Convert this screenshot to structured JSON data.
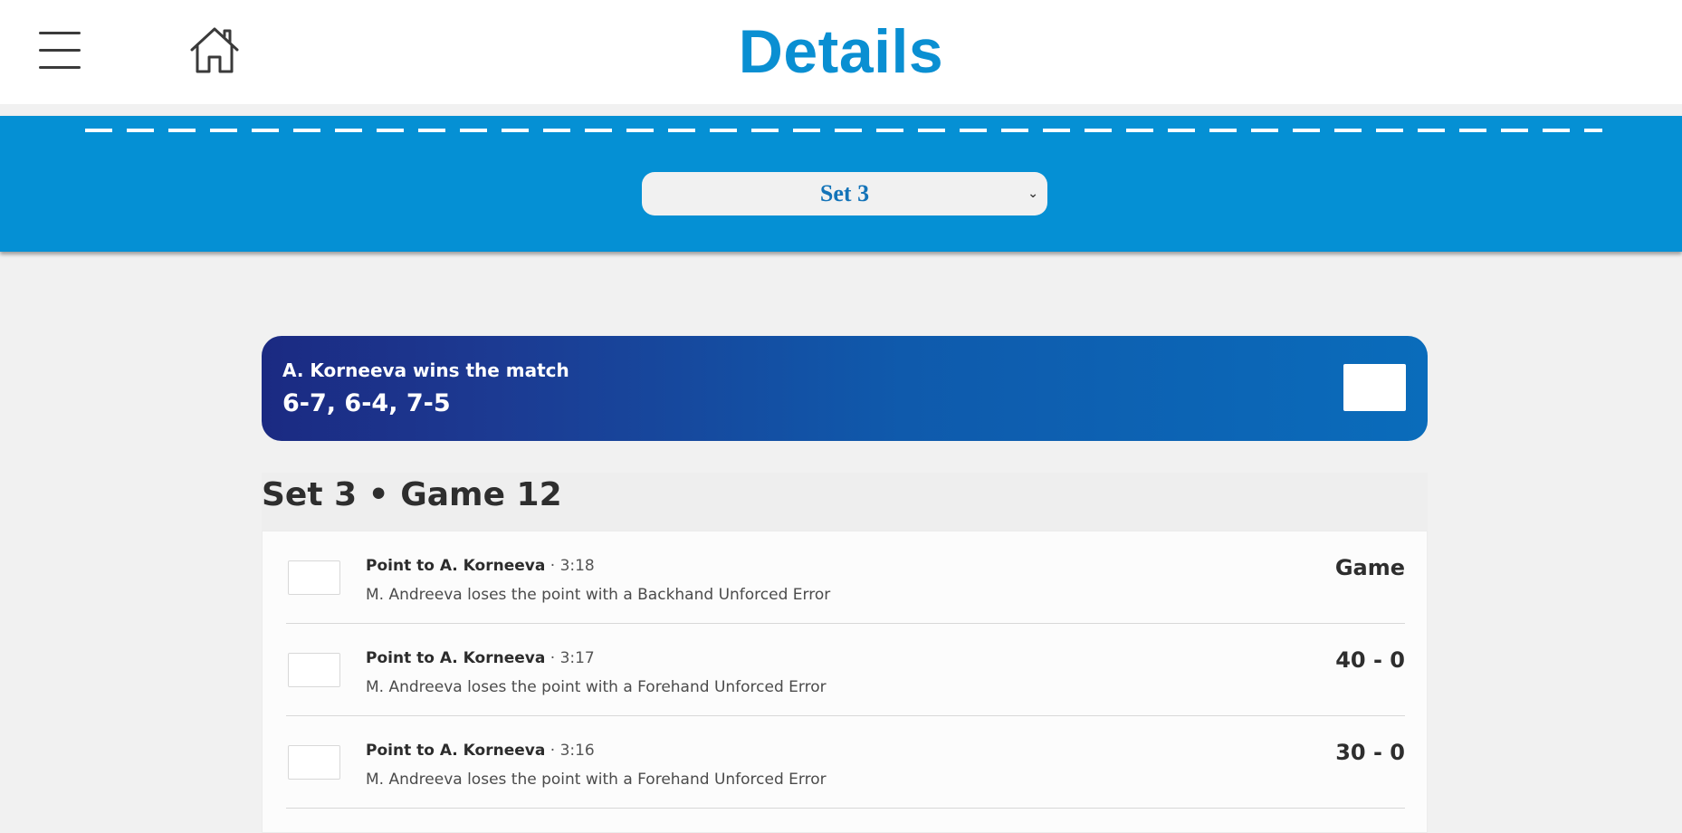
{
  "header": {
    "title": "Details",
    "menu_icon": "hamburger-menu-icon",
    "home_icon": "home-icon"
  },
  "set_selector": {
    "value": "Set 3",
    "chevron": "⌄"
  },
  "result": {
    "title": "A. Korneeva wins the match",
    "score": "6-7, 6-4, 7-5"
  },
  "section": {
    "title": "Set 3 • Game 12"
  },
  "points": [
    {
      "winner": "Point to A. Korneeva",
      "separator": " · ",
      "time": "3:18",
      "description": "M. Andreeva loses the point with a Backhand Unforced Error",
      "score": "Game"
    },
    {
      "winner": "Point to A. Korneeva",
      "separator": " · ",
      "time": "3:17",
      "description": "M. Andreeva loses the point with a Forehand Unforced Error",
      "score": "40 - 0"
    },
    {
      "winner": "Point to A. Korneeva",
      "separator": " · ",
      "time": "3:16",
      "description": "M. Andreeva loses the point with a Forehand Unforced Error",
      "score": "30 - 0"
    }
  ],
  "colors": {
    "accent": "#0590d4",
    "title": "#0a8fd2",
    "card_start": "#1b2a82",
    "card_end": "#0a6cbb"
  }
}
